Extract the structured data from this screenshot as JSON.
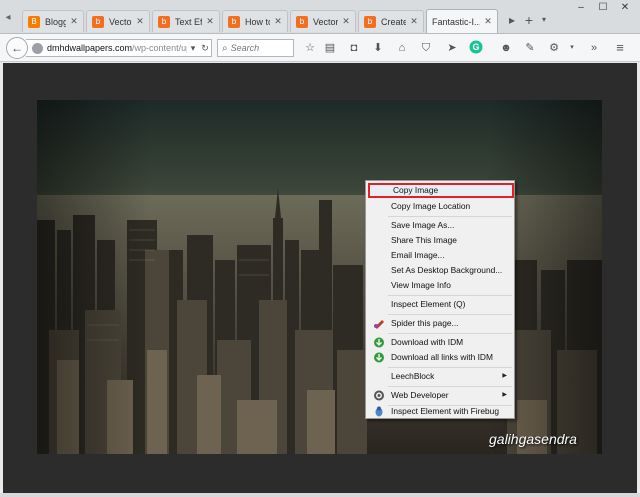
{
  "tabs": [
    {
      "title": "Blogger: ...",
      "favicon": "blogger-icon"
    },
    {
      "title": "Vector - ...",
      "favicon": "orange-b-icon"
    },
    {
      "title": "Text Effec...",
      "favicon": "orange-b-icon"
    },
    {
      "title": "How to C...",
      "favicon": "orange-b-icon"
    },
    {
      "title": "Vector - ...",
      "favicon": "orange-b-icon"
    },
    {
      "title": "Create a ...",
      "favicon": "orange-b-icon"
    },
    {
      "title": "Fantastic-I...",
      "favicon": "none",
      "active": true
    }
  ],
  "url": {
    "host": "dmhdwallpapers.com",
    "path": "/wp-content/up"
  },
  "search": {
    "placeholder": "Search"
  },
  "context_menu": {
    "items": [
      {
        "label": "Copy Image",
        "highlight": true
      },
      {
        "label": "Copy Image Location"
      },
      {
        "sep": true
      },
      {
        "label": "Save Image As..."
      },
      {
        "label": "Share This Image"
      },
      {
        "label": "Email Image..."
      },
      {
        "label": "Set As Desktop Background..."
      },
      {
        "label": "View Image Info"
      },
      {
        "sep": true
      },
      {
        "label": "Inspect Element (Q)"
      },
      {
        "sep": true
      },
      {
        "label": "Spider this page...",
        "icon": "spider-icon"
      },
      {
        "sep": true
      },
      {
        "label": "Download with IDM",
        "icon": "idm-icon"
      },
      {
        "label": "Download all links with IDM",
        "icon": "idm-icon"
      },
      {
        "sep": true
      },
      {
        "label": "LeechBlock",
        "submenu": true
      },
      {
        "sep": true
      },
      {
        "label": "Web Developer",
        "submenu": true,
        "icon": "web-developer-icon"
      },
      {
        "sep": true
      },
      {
        "label": "Inspect Element with Firebug",
        "icon": "firebug-icon"
      }
    ]
  },
  "watermark": "galihgasendra",
  "colors": {
    "highlight_border": "#e32026",
    "tab_favicon": "#f26f21",
    "page_bg": "#2c2c2c"
  }
}
